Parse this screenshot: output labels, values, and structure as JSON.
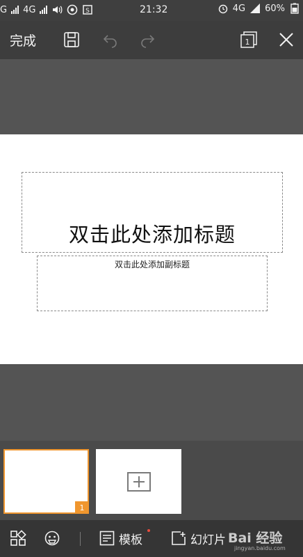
{
  "status_bar": {
    "left_text": "G",
    "network_label": "4G",
    "time": "21:32",
    "right_network": "4G",
    "battery": "60%"
  },
  "toolbar": {
    "done_label": "完成",
    "icons": [
      "save-icon",
      "undo-icon",
      "redo-icon",
      "slide-count-icon",
      "close-icon"
    ],
    "slide_count_badge": "1"
  },
  "slide": {
    "title_placeholder": "双击此处添加标题",
    "subtitle_placeholder": "双击此处添加副标题"
  },
  "thumbnails": {
    "slides": [
      {
        "number": "1",
        "selected": true
      }
    ],
    "add_icon": "plus-icon"
  },
  "bottom_bar": {
    "template_label": "模板",
    "slide_label": "幻灯片",
    "watermark": "Bai 经验",
    "watermark_url": "jingyan.baidu.com"
  },
  "colors": {
    "accent": "#f0962e",
    "notification_dot": "#e84c3d",
    "toolbar_bg": "#3d3d3d",
    "workspace_bg": "#545454"
  }
}
